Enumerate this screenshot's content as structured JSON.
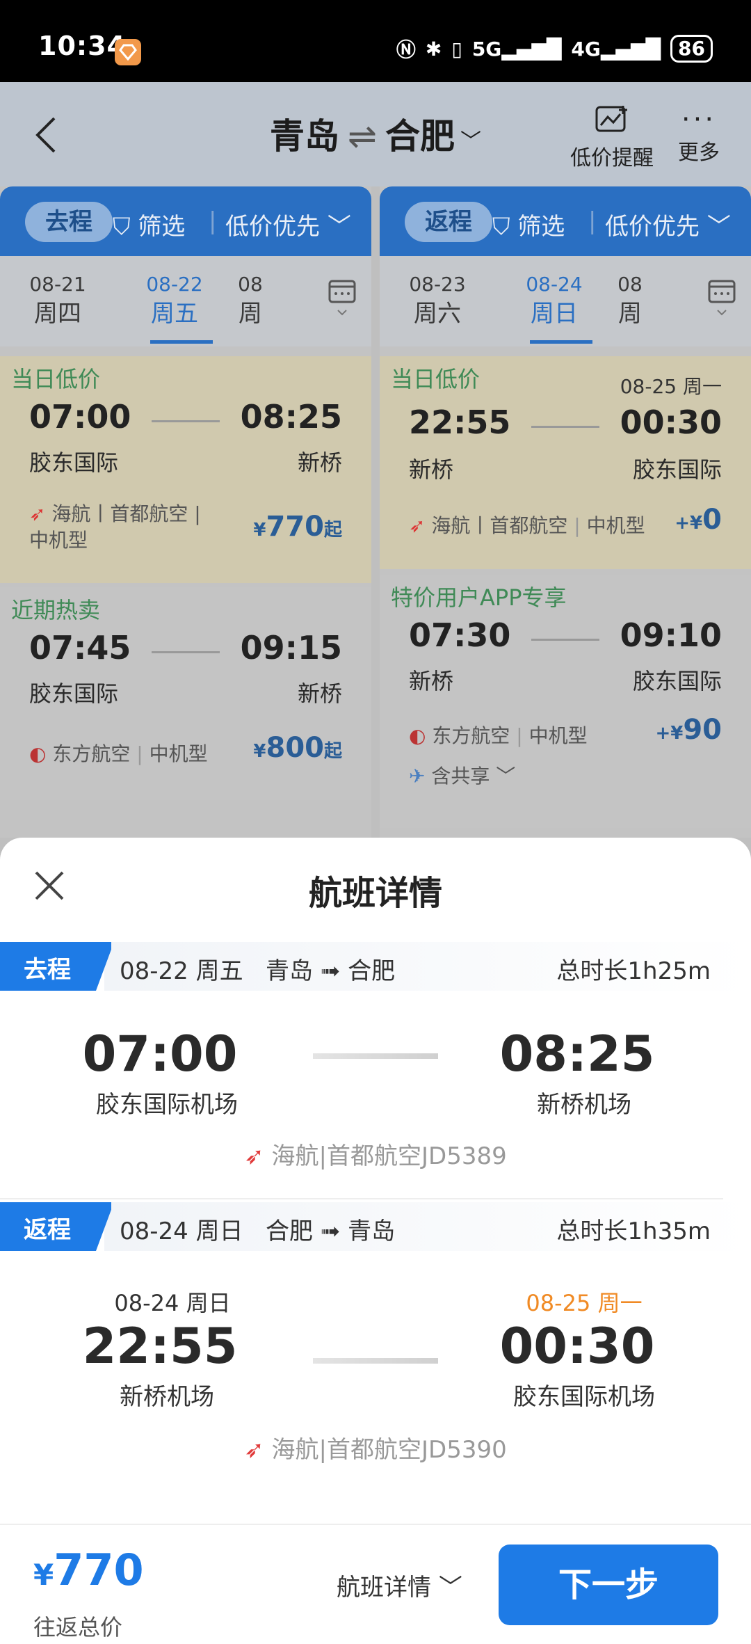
{
  "status": {
    "time": "10:34",
    "battery": "86",
    "net1": "5G",
    "net2": "4G"
  },
  "header": {
    "from": "青岛",
    "swap": "⇌",
    "to": "合肥",
    "price_alert": "低价提醒",
    "more": "更多"
  },
  "outbound_col": {
    "pill": "去程",
    "filter": "筛选",
    "sort": "低价优先",
    "dates": [
      {
        "date": "08-21",
        "weekday": "周四"
      },
      {
        "date": "08-22",
        "weekday": "周五"
      },
      {
        "date": "08",
        "weekday": "周"
      }
    ],
    "flights": [
      {
        "tag": "当日低价",
        "dep": "07:00",
        "arr": "08:25",
        "dep_ap": "胶东国际",
        "arr_ap": "新桥",
        "airline": "海航丨首都航空 |",
        "aircraft": "中机型",
        "price": "770",
        "suffix": "起"
      },
      {
        "tag": "近期热卖",
        "dep": "07:45",
        "arr": "09:15",
        "dep_ap": "胶东国际",
        "arr_ap": "新桥",
        "airline": "东方航空",
        "aircraft": "中机型",
        "price": "800",
        "suffix": "起"
      }
    ]
  },
  "return_col": {
    "pill": "返程",
    "filter": "筛选",
    "sort": "低价优先",
    "dates": [
      {
        "date": "08-23",
        "weekday": "周六"
      },
      {
        "date": "08-24",
        "weekday": "周日"
      },
      {
        "date": "08",
        "weekday": "周"
      }
    ],
    "flights": [
      {
        "tag": "当日低价",
        "next_day": "08-25 周一",
        "dep": "22:55",
        "arr": "00:30",
        "dep_ap": "新桥",
        "arr_ap": "胶东国际",
        "airline": "海航丨首都航空",
        "aircraft": "中机型",
        "price": "0"
      },
      {
        "tag": "特价用户APP专享",
        "dep": "07:30",
        "arr": "09:10",
        "dep_ap": "新桥",
        "arr_ap": "胶东国际",
        "airline": "东方航空",
        "aircraft": "中机型",
        "price": "90",
        "share": "含共享"
      }
    ]
  },
  "sheet": {
    "title": "航班详情",
    "outbound": {
      "label": "去程",
      "date": "08-22 周五",
      "from": "青岛",
      "to": "合肥",
      "duration": "总时长1h25m",
      "dep": "07:00",
      "arr": "08:25",
      "dep_ap": "胶东国际机场",
      "arr_ap": "新桥机场",
      "carrier": "海航|首都航空JD5389"
    },
    "return": {
      "label": "返程",
      "date": "08-24 周日",
      "from": "合肥",
      "to": "青岛",
      "duration": "总时长1h35m",
      "dep_date": "08-24 周日",
      "arr_date": "08-25 周一",
      "dep": "22:55",
      "arr": "00:30",
      "dep_ap": "新桥机场",
      "arr_ap": "胶东国际机场",
      "carrier": "海航|首都航空JD5390"
    }
  },
  "footer": {
    "currency": "¥",
    "total": "770",
    "total_label": "往返总价",
    "detail": "航班详情",
    "next": "下一步"
  },
  "symbols": {
    "yen": "¥",
    "plus_yen": "+¥",
    "sep": "|"
  },
  "colors": {
    "brand_blue": "#1e7be6",
    "tag_green": "#3f8a56",
    "next_day_orange": "#f08a24"
  }
}
